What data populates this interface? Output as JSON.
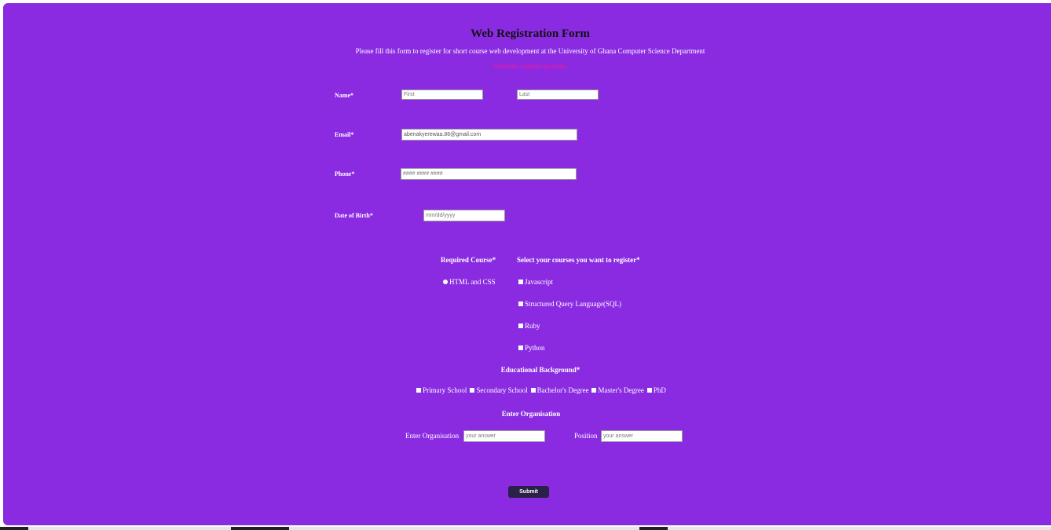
{
  "form": {
    "title": "Web Registration Form",
    "subtitle": "Please fill this form to register for short course web development at the University of Ghana Computer Science Department",
    "required_note": "*indicates required questions",
    "name": {
      "label": "Name*",
      "first_placeholder": "First",
      "last_placeholder": "Last"
    },
    "email": {
      "label": "Email*",
      "placeholder": "abenakyerewaa.86@gmail.com"
    },
    "phone": {
      "label": "Phone*",
      "placeholder": "#### #### ####"
    },
    "dob": {
      "label": "Date of Birth*",
      "placeholder": "mm/dd/yyyy"
    },
    "required_course": {
      "heading": "Required Course*",
      "option": "HTML and CSS"
    },
    "courses": {
      "heading": "Select your courses you want to register*",
      "options": [
        "Javascript",
        "Structured Query Language(SQL)",
        "Ruby",
        "Python"
      ]
    },
    "education": {
      "heading": "Educational Background*",
      "options": [
        "Primary School",
        "Secondary School",
        "Bachelor's Degree",
        "Master's Degree",
        "PhD"
      ]
    },
    "organisation": {
      "heading": "Enter Organisation",
      "org_label": "Enter Organisation",
      "org_placeholder": "your answer",
      "position_label": "Position",
      "position_placeholder": "your answer"
    },
    "submit_label": "Submit"
  },
  "colors": {
    "background": "#8a2be2",
    "accent_note": "#ff1493",
    "submit": "#2a2148"
  }
}
